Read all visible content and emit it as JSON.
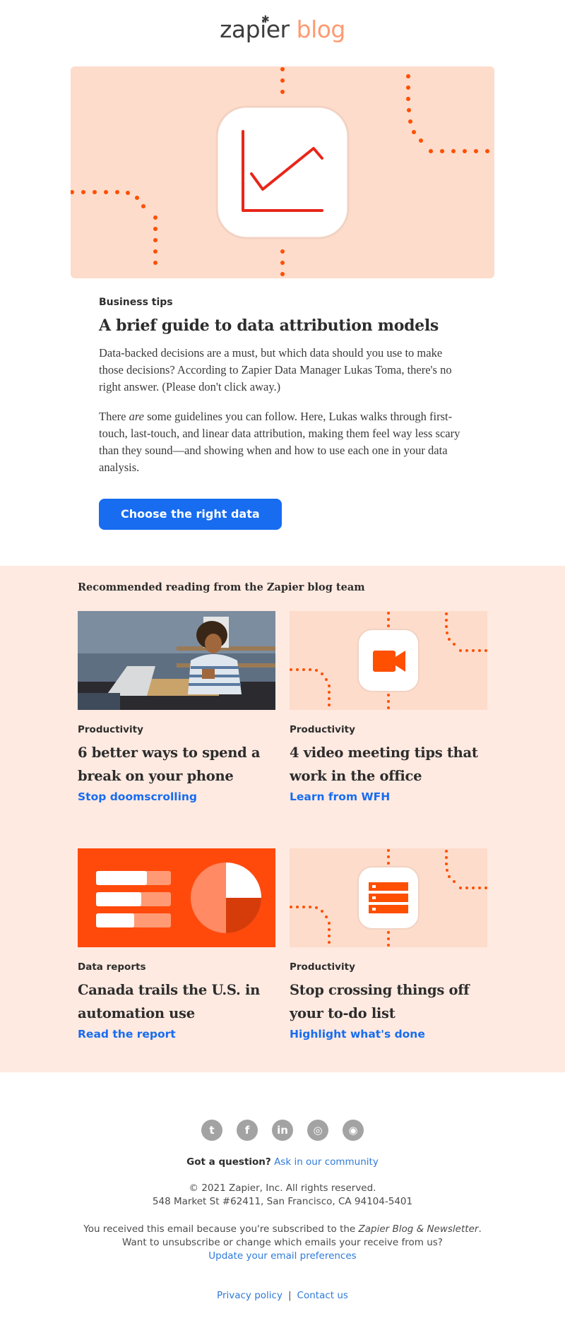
{
  "header": {
    "logo_word1": "zapier",
    "logo_word2": "blog",
    "logo_mark": "✱"
  },
  "hero": {
    "background": "#fddccb",
    "dot_color": "#ff4f00",
    "icon": "line-chart-icon",
    "icon_color": "#e8261a"
  },
  "article": {
    "category": "Business tips",
    "title": "A brief guide to data attribution models",
    "para1": "Data-backed decisions are a must, but which data should you use to make those decisions? According to Zapier Data Manager Lukas Toma, there's no right answer. (Please don't click away.)",
    "para2_before": "There ",
    "para2_em": "are",
    "para2_after": " some guidelines you can follow. Here, Lukas walks through first-touch, last-touch, and linear data attribution, making them feel way less scary than they sound—and showing when and how to use each one in your data analysis.",
    "cta_label": "Choose the right data",
    "cta_color": "#176cf0"
  },
  "recommended": {
    "heading": "Recommended reading from the Zapier blog team",
    "background": "#ffeae1",
    "cards": [
      {
        "category": "Productivity",
        "title": "6 better ways to spend a break on your phone",
        "link": "Stop doomscrolling",
        "image": "person-using-phone-photo"
      },
      {
        "category": "Productivity",
        "title": "4 video meeting tips that work in the office",
        "link": "Learn from WFH",
        "image": "video-camera-icon"
      },
      {
        "category": "Data reports",
        "title": "Canada trails the U.S. in automation use",
        "link": "Read the report",
        "image": "bar-and-pie-chart-graphic"
      },
      {
        "category": "Productivity",
        "title": "Stop crossing things off your to-do list",
        "link": "Highlight what's done",
        "image": "list-icon"
      }
    ]
  },
  "footer": {
    "socials": [
      {
        "name": "twitter-icon",
        "glyph": "t"
      },
      {
        "name": "facebook-icon",
        "glyph": "f"
      },
      {
        "name": "linkedin-icon",
        "glyph": "in"
      },
      {
        "name": "instagram-icon",
        "glyph": "◎"
      },
      {
        "name": "rss-icon",
        "glyph": "◉"
      }
    ],
    "question": "Got a question?",
    "community_link": "Ask in our community",
    "copyright": "© 2021 Zapier, Inc. All rights reserved.",
    "address": "548 Market St #62411, San Francisco, CA 94104-5401",
    "notice_before": "You received this email because you're subscribed to the ",
    "notice_em": "Zapier Blog & Newsletter",
    "notice_after": ".",
    "notice_line2": "Want to unsubscribe or change which emails your receive from us?",
    "prefs_link": "Update your email preferences",
    "privacy_link": "Privacy policy",
    "separator": "|",
    "contact_link": "Contact us"
  }
}
